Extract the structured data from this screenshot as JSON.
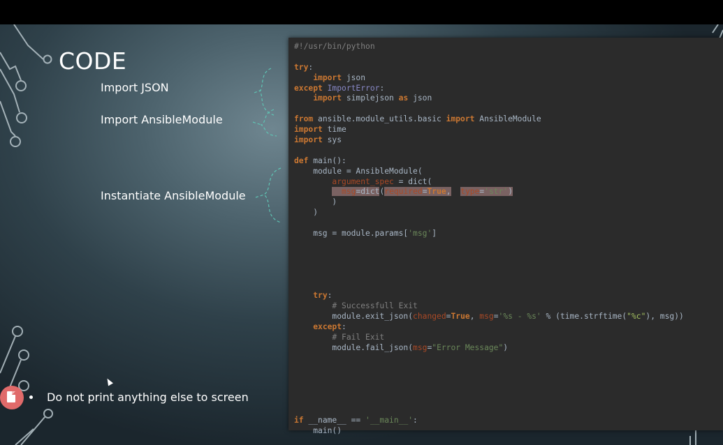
{
  "slide": {
    "title": "CODE",
    "annotations": {
      "import_json": "Import JSON",
      "import_module": "Import AnsibleModule",
      "instantiate": "Instantiate AnsibleModule"
    },
    "bullet": "Do not print anything else to screen",
    "colors": {
      "background": "#2f414a",
      "code_bg": "#2b2b2b",
      "keyword": "#cc7832",
      "string": "#6a8759",
      "badge": "#e06a6a"
    },
    "icons": [
      "document-icon",
      "mouse-cursor-icon"
    ]
  },
  "code_lines": [
    [
      {
        "t": "#!/usr/bin/python",
        "c": "cm"
      }
    ],
    [],
    [
      {
        "t": "try",
        "c": "kw"
      },
      {
        "t": ":"
      }
    ],
    [
      {
        "t": "    "
      },
      {
        "t": "import",
        "c": "kw"
      },
      {
        "t": " json"
      }
    ],
    [
      {
        "t": "except",
        "c": "kw"
      },
      {
        "t": " "
      },
      {
        "t": "ImportError",
        "c": "imp"
      },
      {
        "t": ":"
      }
    ],
    [
      {
        "t": "    "
      },
      {
        "t": "import",
        "c": "kw"
      },
      {
        "t": " simplejson "
      },
      {
        "t": "as",
        "c": "kw"
      },
      {
        "t": " json"
      }
    ],
    [],
    [
      {
        "t": "from",
        "c": "kw"
      },
      {
        "t": " ansible.module_utils.basic "
      },
      {
        "t": "import",
        "c": "kw"
      },
      {
        "t": " AnsibleModule"
      }
    ],
    [
      {
        "t": "import",
        "c": "kw"
      },
      {
        "t": " time"
      }
    ],
    [
      {
        "t": "import",
        "c": "kw"
      },
      {
        "t": " sys"
      }
    ],
    [],
    [
      {
        "t": "def",
        "c": "kw"
      },
      {
        "t": " main():"
      }
    ],
    [
      {
        "t": "    module = AnsibleModule("
      }
    ],
    [
      {
        "t": "        "
      },
      {
        "t": "argument_spec",
        "c": "pm"
      },
      {
        "t": " = dict("
      }
    ],
    [
      {
        "t": "        "
      },
      {
        "t": "  msg",
        "c": "pm hl"
      },
      {
        "t": "=dict",
        "c": "hl"
      },
      {
        "t": "("
      },
      {
        "t": "required",
        "c": "pm hl"
      },
      {
        "t": "=",
        "c": "hl"
      },
      {
        "t": "True",
        "c": "kw hl"
      },
      {
        "t": ",",
        "c": "hl"
      },
      {
        "t": "  "
      },
      {
        "t": "type",
        "c": "pm hl"
      },
      {
        "t": "=",
        "c": "hl"
      },
      {
        "t": "'str'",
        "c": "str hl"
      },
      {
        "t": ")",
        "c": "hl"
      }
    ],
    [
      {
        "t": "        )"
      }
    ],
    [
      {
        "t": "    )"
      }
    ],
    [],
    [
      {
        "t": "    msg = module.params["
      },
      {
        "t": "'msg'",
        "c": "str"
      },
      {
        "t": "]"
      }
    ],
    [],
    [],
    [],
    [],
    [],
    [
      {
        "t": "    "
      },
      {
        "t": "try",
        "c": "kw"
      },
      {
        "t": ":"
      }
    ],
    [
      {
        "t": "        "
      },
      {
        "t": "# Successfull Exit",
        "c": "cm"
      }
    ],
    [
      {
        "t": "        module.exit_json("
      },
      {
        "t": "changed",
        "c": "pm"
      },
      {
        "t": "="
      },
      {
        "t": "True",
        "c": "kw"
      },
      {
        "t": ", "
      },
      {
        "t": "msg",
        "c": "pm"
      },
      {
        "t": "="
      },
      {
        "t": "'%s - %s'",
        "c": "str"
      },
      {
        "t": " % (time.strftime("
      },
      {
        "t": "\"%c\"",
        "c": "str2"
      },
      {
        "t": "), msg))"
      }
    ],
    [
      {
        "t": "    "
      },
      {
        "t": "except",
        "c": "kw"
      },
      {
        "t": ":"
      }
    ],
    [
      {
        "t": "        "
      },
      {
        "t": "# Fail Exit",
        "c": "cm"
      }
    ],
    [
      {
        "t": "        module.fail_json("
      },
      {
        "t": "msg",
        "c": "pm"
      },
      {
        "t": "="
      },
      {
        "t": "\"Error Message\"",
        "c": "str"
      },
      {
        "t": ")"
      }
    ],
    [],
    [],
    [],
    [],
    [],
    [],
    [
      {
        "t": "if",
        "c": "kw"
      },
      {
        "t": " __name__ == "
      },
      {
        "t": "'__main__'",
        "c": "str"
      },
      {
        "t": ":"
      }
    ],
    [
      {
        "t": "    main()"
      }
    ]
  ]
}
